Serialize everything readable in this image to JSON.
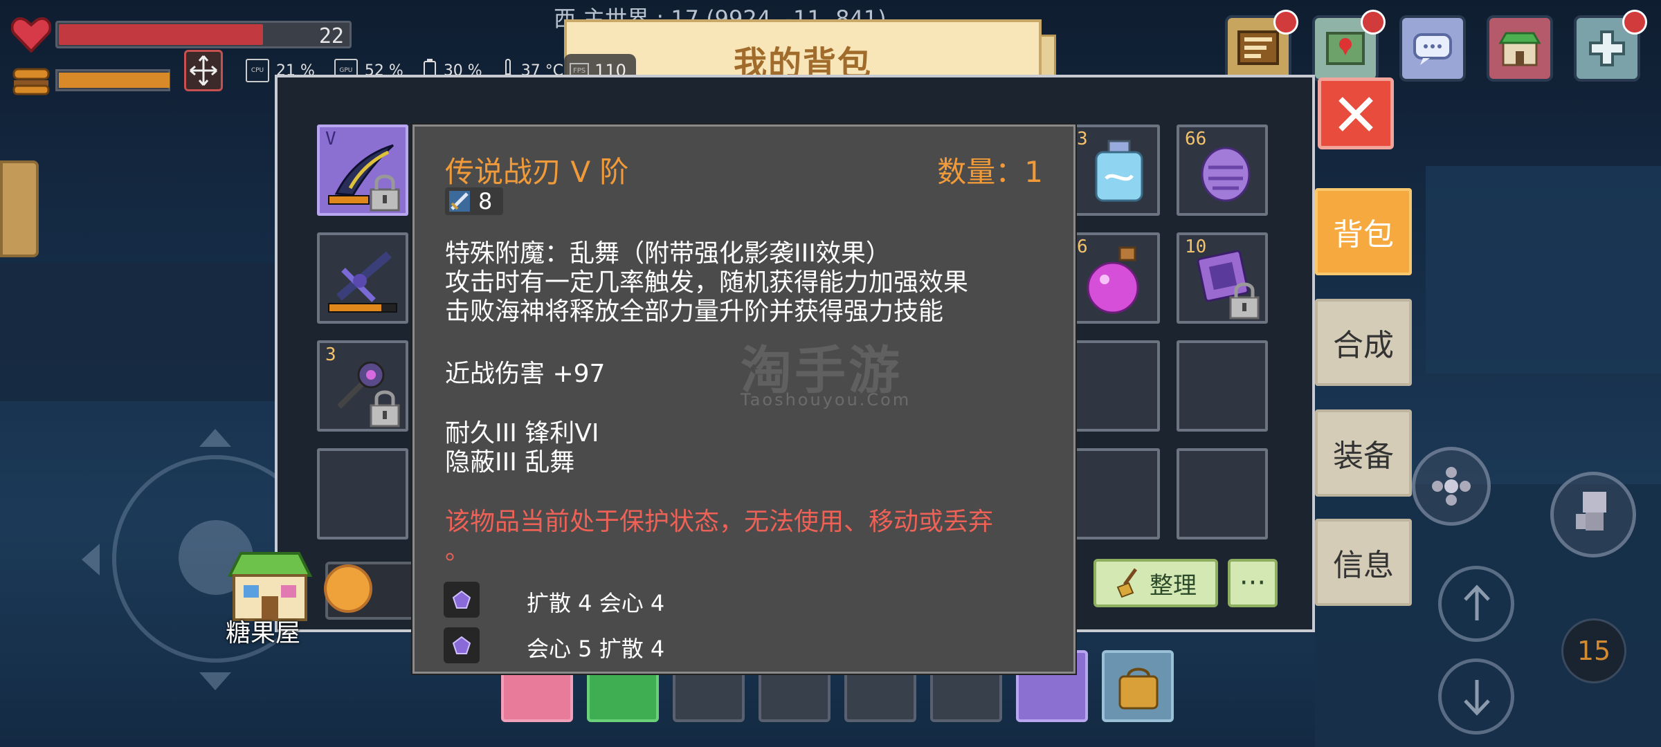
{
  "hud": {
    "hp_value": "22",
    "hp_fraction": 0.7,
    "food_fraction": 1.0,
    "perf": {
      "cpu_label": "CPU",
      "cpu": "21 %",
      "gpu_label": "GPU",
      "gpu": "52 %",
      "battery": "30 %",
      "temp": "37 °C",
      "fps_label": "FPS",
      "fps": "110"
    },
    "coords": "西  主世界 : 17  (9924, -11, 841)"
  },
  "header": {
    "title": "我的背包"
  },
  "tabs": [
    {
      "label": "背包",
      "active": true
    },
    {
      "label": "合成",
      "active": false
    },
    {
      "label": "装备",
      "active": false
    },
    {
      "label": "信息",
      "active": false
    }
  ],
  "inventory": {
    "left_column": [
      {
        "icon": "purple-blade-icon",
        "tier": "V",
        "locked": true,
        "durability": 0.7
      },
      {
        "icon": "crossbow-icon",
        "locked": false,
        "durability": 0.78
      },
      {
        "icon": "mace-icon",
        "count": "3",
        "locked": true
      },
      {
        "icon": "empty"
      }
    ],
    "right_slots": [
      {
        "icon": "blue-potion-icon",
        "count": "3"
      },
      {
        "icon": "purple-crystal-icon",
        "count": "66"
      },
      {
        "icon": "pink-potion-icon",
        "count": "6"
      },
      {
        "icon": "purple-tablet-icon",
        "count": "10",
        "locked": true
      }
    ],
    "tidy_label": "整理",
    "more_label": "···"
  },
  "tooltip": {
    "name": "传说战刃 V 阶",
    "quantity": "数量：1",
    "level": "8",
    "lines": [
      "特殊附魔：乱舞（附带强化影袭III效果）",
      "攻击时有一定几率触发，随机获得能力加强效果",
      "击败海神将释放全部力量升阶并获得强力技能",
      "近战伤害 +97",
      "耐久III    锋利VI",
      "隐蔽III    乱舞"
    ],
    "warning_1": "该物品当前处于保护状态，无法使用、移动或丢弃",
    "warning_2": "。",
    "gems": [
      "扩散 4    会心 4",
      "会心 5    扩散 4"
    ]
  },
  "watermark": {
    "title": "淘手游",
    "sub": "Taoshouyou.Com"
  },
  "world": {
    "house_label": "糖果屋",
    "gold_count": "15"
  },
  "colors": {
    "accent_orange": "#f09a3a",
    "warning_red": "#ee6156",
    "tab_active": "#f5a93f",
    "close_red": "#e74c3c"
  }
}
